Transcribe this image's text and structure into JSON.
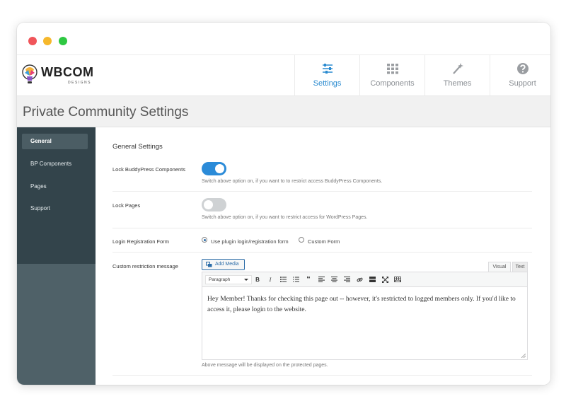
{
  "window": {
    "controls": [
      "close",
      "minimize",
      "maximize"
    ]
  },
  "brand": {
    "name": "WBCOM",
    "tagline": "DESIGNS"
  },
  "nav": {
    "tabs": [
      {
        "label": "Settings",
        "icon": "sliders-icon",
        "active": true
      },
      {
        "label": "Components",
        "icon": "grid-icon",
        "active": false
      },
      {
        "label": "Themes",
        "icon": "magic-wand-icon",
        "active": false
      },
      {
        "label": "Support",
        "icon": "question-circle-icon",
        "active": false
      }
    ]
  },
  "page": {
    "title": "Private Community Settings"
  },
  "sidebar": {
    "items": [
      {
        "label": "General",
        "active": true
      },
      {
        "label": "BP Components",
        "active": false
      },
      {
        "label": "Pages",
        "active": false
      },
      {
        "label": "Support",
        "active": false
      }
    ]
  },
  "content": {
    "section_title": "General Settings",
    "lock_components": {
      "label": "Lock BuddyPress Components",
      "enabled": true,
      "hint": "Switch above option on, if you want to to restrict access BuddyPress Components."
    },
    "lock_pages": {
      "label": "Lock Pages",
      "enabled": false,
      "hint": "Switch above option on, if you want to restrict access for WordPress Pages."
    },
    "login_form": {
      "label": "Login Registration Form",
      "options": [
        "Use plugin login/registration form",
        "Custom Form"
      ],
      "selected": "Use plugin login/registration form"
    },
    "restriction_message": {
      "label": "Custom restriction message",
      "add_media": "Add Media",
      "tab_visual": "Visual",
      "tab_text": "Text",
      "format_select": "Paragraph",
      "toolbar_icons": [
        "bold-icon",
        "italic-icon",
        "bullet-list-icon",
        "numbered-list-icon",
        "blockquote-icon",
        "align-left-icon",
        "align-center-icon",
        "align-right-icon",
        "link-icon",
        "read-more-icon",
        "fullscreen-icon",
        "toolbar-toggle-icon"
      ],
      "body": "Hey Member! Thanks for checking this page out -- however, it's restricted to logged members only. If you'd like to access it, please login to the website.",
      "hint": "Above message will be displayed on the protected pages."
    }
  },
  "colors": {
    "accent": "#2b8bd8",
    "sidebar": "#33444b",
    "sidebar_lower": "#4f6168"
  }
}
